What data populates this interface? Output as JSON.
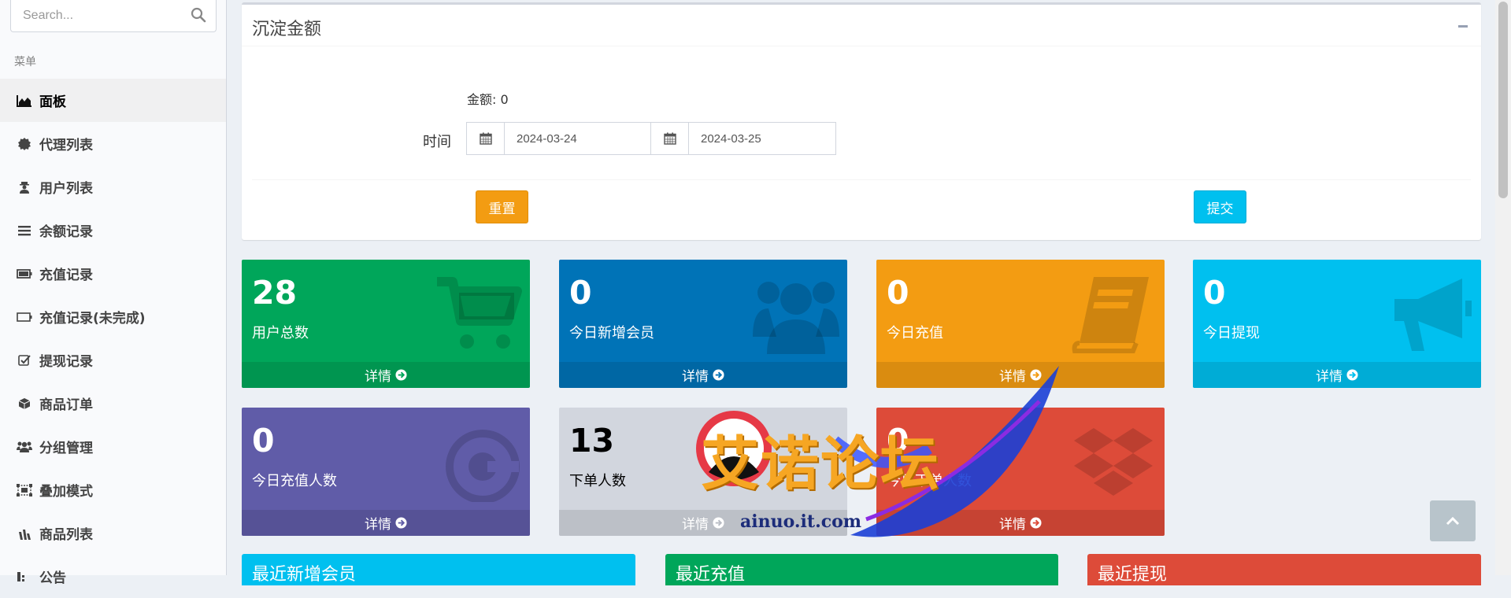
{
  "sidebar": {
    "search_placeholder": "Search...",
    "menu_header": "菜单",
    "items": [
      {
        "label": "面板",
        "icon": "area-chart-icon",
        "active": true
      },
      {
        "label": "代理列表",
        "icon": "certificate-icon"
      },
      {
        "label": "用户列表",
        "icon": "user-secret-icon"
      },
      {
        "label": "余额记录",
        "icon": "list-icon"
      },
      {
        "label": "充值记录",
        "icon": "battery-icon"
      },
      {
        "label": "充值记录(未完成)",
        "icon": "battery-empty-icon"
      },
      {
        "label": "提现记录",
        "icon": "check-square-icon"
      },
      {
        "label": "商品订单",
        "icon": "cube-icon"
      },
      {
        "label": "分组管理",
        "icon": "users-icon"
      },
      {
        "label": "叠加模式",
        "icon": "object-group-icon"
      },
      {
        "label": "商品列表",
        "icon": "product-hunt-icon"
      },
      {
        "label": "公告",
        "icon": "bullhorn-icon"
      }
    ]
  },
  "filter_box": {
    "title": "沉淀金额",
    "amount_label": "金额:",
    "amount_value": "0",
    "time_label": "时间",
    "date_from": "2024-03-24",
    "date_to": "2024-03-25",
    "reset_label": "重置",
    "submit_label": "提交"
  },
  "tiles": [
    {
      "value": "28",
      "label": "用户总数",
      "more": "详情",
      "color": "#00a65a",
      "icon": "shopping-cart-icon"
    },
    {
      "value": "0",
      "label": "今日新增会员",
      "more": "详情",
      "color": "#0073b7",
      "icon": "users-icon"
    },
    {
      "value": "0",
      "label": "今日充值",
      "more": "详情",
      "color": "#f39c12",
      "icon": "book-icon"
    },
    {
      "value": "0",
      "label": "今日提现",
      "more": "详情",
      "color": "#00c0ef",
      "icon": "bullhorn-icon"
    },
    {
      "value": "0",
      "label": "今日充值人数",
      "more": "详情",
      "color": "#605ca8",
      "icon": "cc-icon"
    },
    {
      "value": "13",
      "label": "下单人数",
      "more": "详情",
      "color": "#d2d6de",
      "icon": "none"
    },
    {
      "value": "0",
      "label": "今日下单人数",
      "more": "详情",
      "color": "#dd4b39",
      "icon": "dropbox-icon"
    }
  ],
  "lower_boxes": [
    {
      "title": "最近新增会员",
      "color": "#00c0ef"
    },
    {
      "title": "最近充值",
      "color": "#00a65a"
    },
    {
      "title": "最近提现",
      "color": "#dd4b39"
    }
  ],
  "watermark": {
    "title": "艾诺论坛",
    "url": "ainuo.it.com"
  }
}
